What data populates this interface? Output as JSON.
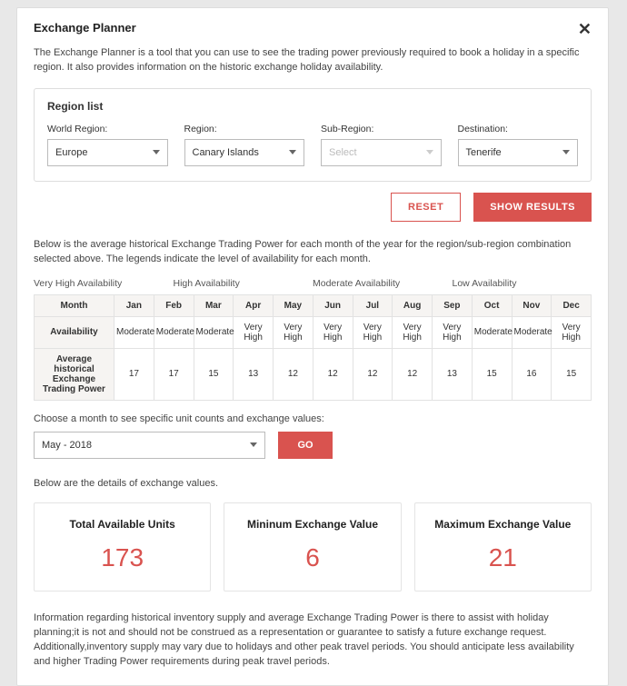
{
  "modal": {
    "title": "Exchange Planner",
    "intro": "The Exchange Planner is a tool that you can use to see the trading power previously required to book a holiday in a specific region. It also provides information on the historic exchange holiday availability."
  },
  "region": {
    "box_title": "Region list",
    "world_label": "World Region:",
    "world_value": "Europe",
    "region_label": "Region:",
    "region_value": "Canary Islands",
    "sub_label": "Sub-Region:",
    "sub_placeholder": "Select",
    "dest_label": "Destination:",
    "dest_value": "Tenerife"
  },
  "actions": {
    "reset": "RESET",
    "show": "SHOW RESULTS"
  },
  "tableintro": "Below is the average historical Exchange Trading Power for each month of the year for the region/sub-region combination selected above. The legends indicate the level of availability for each month.",
  "legend": {
    "a": "Very High Availability",
    "b": "High Availability",
    "c": "Moderate Availability",
    "d": "Low Availability"
  },
  "table": {
    "h_month": "Month",
    "h_avail": "Availability",
    "h_avg": "Average historical Exchange Trading Power",
    "months": {
      "m1": "Jan",
      "m2": "Feb",
      "m3": "Mar",
      "m4": "Apr",
      "m5": "May",
      "m6": "Jun",
      "m7": "Jul",
      "m8": "Aug",
      "m9": "Sep",
      "m10": "Oct",
      "m11": "Nov",
      "m12": "Dec"
    },
    "avail": {
      "m1": "Moderate",
      "m2": "Moderate",
      "m3": "Moderate",
      "m4": "Very High",
      "m5": "Very High",
      "m6": "Very High",
      "m7": "Very High",
      "m8": "Very High",
      "m9": "Very High",
      "m10": "Moderate",
      "m11": "Moderate",
      "m12": "Very High"
    },
    "power": {
      "m1": "17",
      "m2": "17",
      "m3": "15",
      "m4": "13",
      "m5": "12",
      "m6": "12",
      "m7": "12",
      "m8": "12",
      "m9": "13",
      "m10": "15",
      "m11": "16",
      "m12": "15"
    }
  },
  "monthpick": {
    "label": "Choose a month to see specific unit counts and exchange values:",
    "value": "May - 2018",
    "go": "GO"
  },
  "details_intro": "Below are the details of exchange values.",
  "cards": {
    "c1_title": "Total Available Units",
    "c1_value": "173",
    "c2_title": "Mininum Exchange Value",
    "c2_value": "6",
    "c3_title": "Maximum Exchange Value",
    "c3_value": "21"
  },
  "disclaimer": "Information regarding historical inventory supply and average Exchange Trading Power is there to assist with holiday planning;it is not and should not be construed as a representation or guarantee to satisfy a future exchange request. Additionally,inventory supply may vary due to holidays and other peak travel periods. You should anticipate less availability and higher Trading Power requirements during peak travel periods."
}
